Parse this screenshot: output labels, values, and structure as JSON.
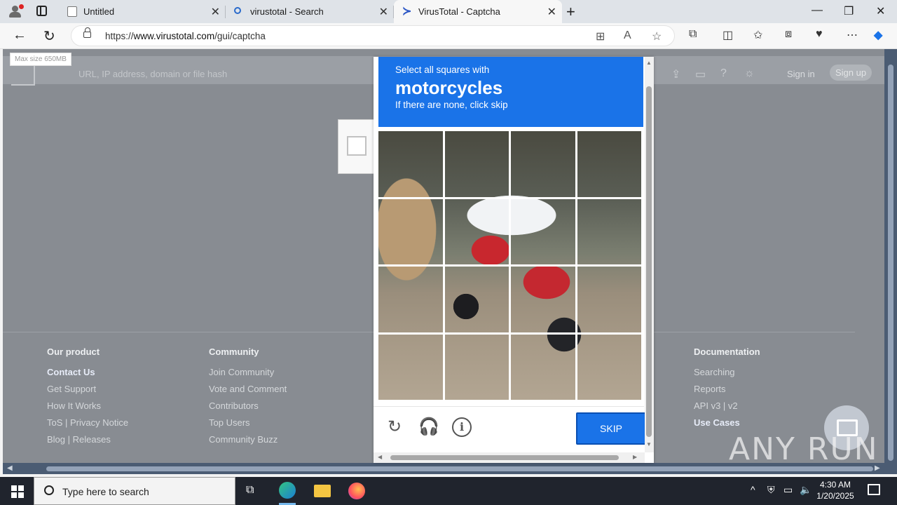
{
  "browser": {
    "tabs": [
      {
        "label": "Untitled",
        "icon": "document-icon",
        "active": false
      },
      {
        "label": "virustotal - Search",
        "icon": "search-icon",
        "active": false
      },
      {
        "label": "VirusTotal - Captcha",
        "icon": "virustotal-icon",
        "active": true
      }
    ],
    "url_prefix": "https://",
    "url_host": "www.virustotal.com",
    "url_path": "/gui/captcha"
  },
  "virustotal": {
    "tooltip": "Max size 650MB",
    "search_placeholder": "URL, IP address, domain or file hash",
    "sign_in": "Sign in",
    "sign_up": "Sign up",
    "footer": [
      {
        "heading": "Our product",
        "links": [
          "Contact Us",
          "Get Support",
          "How It Works",
          "ToS | Privacy Notice",
          "Blog | Releases"
        ]
      },
      {
        "heading": "Community",
        "links": [
          "Join Community",
          "Vote and Comment",
          "Contributors",
          "Top Users",
          "Community Buzz"
        ]
      },
      {
        "heading": "Documentation",
        "links": [
          "Searching",
          "Reports",
          "API v3 | v2",
          "Use Cases"
        ]
      }
    ]
  },
  "captcha": {
    "instruction_line1": "Select all squares with",
    "target": "motorcycles",
    "instruction_line3": "If there are none, click skip",
    "grid_size": 4,
    "skip_label": "SKIP",
    "accent": "#1a73e8"
  },
  "watermark": "ANY RUN",
  "taskbar": {
    "search_placeholder": "Type here to search",
    "time": "4:30 AM",
    "date": "1/20/2025"
  }
}
